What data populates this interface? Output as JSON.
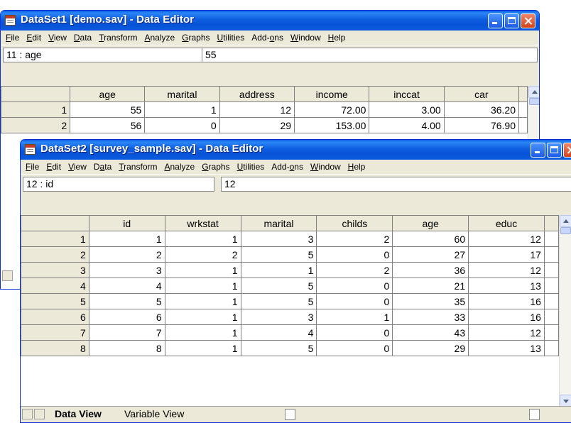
{
  "window1": {
    "title": "DataSet1 [demo.sav] - Data Editor",
    "menu": [
      {
        "label": "File",
        "u": 0
      },
      {
        "label": "Edit",
        "u": 0
      },
      {
        "label": "View",
        "u": 0
      },
      {
        "label": "Data",
        "u": 0
      },
      {
        "label": "Transform",
        "u": 0
      },
      {
        "label": "Analyze",
        "u": 0
      },
      {
        "label": "Graphs",
        "u": 0
      },
      {
        "label": "Utilities",
        "u": 0
      },
      {
        "label": "Add-ons",
        "u": 4
      },
      {
        "label": "Window",
        "u": 0
      },
      {
        "label": "Help",
        "u": 0
      }
    ],
    "cell_ref": "11 : age",
    "cell_value": "55",
    "columns": [
      "age",
      "marital",
      "address",
      "income",
      "inccat",
      "car"
    ],
    "rows": [
      [
        "1",
        "55",
        "1",
        "12",
        "72.00",
        "3.00",
        "36.20"
      ],
      [
        "2",
        "56",
        "0",
        "29",
        "153.00",
        "4.00",
        "76.90"
      ]
    ]
  },
  "window2": {
    "title": "DataSet2 [survey_sample.sav] - Data Editor",
    "menu": [
      {
        "label": "File",
        "u": 0
      },
      {
        "label": "Edit",
        "u": 0
      },
      {
        "label": "View",
        "u": 0
      },
      {
        "label": "Data",
        "u": 1
      },
      {
        "label": "Transform",
        "u": 0
      },
      {
        "label": "Analyze",
        "u": 0
      },
      {
        "label": "Graphs",
        "u": 0
      },
      {
        "label": "Utilities",
        "u": 0
      },
      {
        "label": "Add-ons",
        "u": 4
      },
      {
        "label": "Window",
        "u": 0
      },
      {
        "label": "Help",
        "u": 0
      }
    ],
    "cell_ref": "12 : id",
    "cell_value": "12",
    "columns": [
      "id",
      "wrkstat",
      "marital",
      "childs",
      "age",
      "educ"
    ],
    "rows": [
      [
        "1",
        "1",
        "1",
        "3",
        "2",
        "60",
        "12"
      ],
      [
        "2",
        "2",
        "2",
        "5",
        "0",
        "27",
        "17"
      ],
      [
        "3",
        "3",
        "1",
        "1",
        "2",
        "36",
        "12"
      ],
      [
        "4",
        "4",
        "1",
        "5",
        "0",
        "21",
        "13"
      ],
      [
        "5",
        "5",
        "1",
        "5",
        "0",
        "35",
        "16"
      ],
      [
        "6",
        "6",
        "1",
        "3",
        "1",
        "33",
        "16"
      ],
      [
        "7",
        "7",
        "1",
        "4",
        "0",
        "43",
        "12"
      ],
      [
        "8",
        "8",
        "1",
        "5",
        "0",
        "29",
        "13"
      ]
    ],
    "tabs": {
      "data_view": "Data View",
      "variable_view": "Variable View"
    }
  }
}
